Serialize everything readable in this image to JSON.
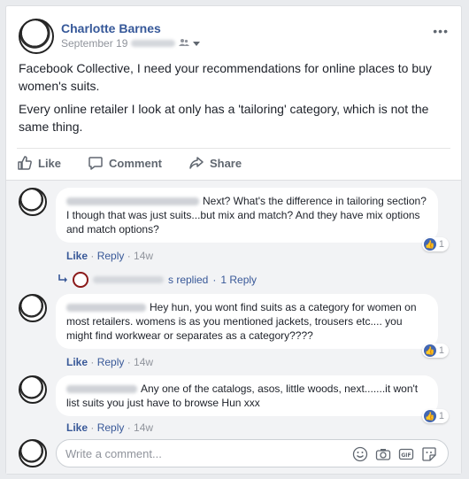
{
  "post": {
    "author": "Charlotte Barnes",
    "date": "September 19",
    "paragraphs": [
      "Facebook Collective, I need your recommendations for online places to buy women's suits.",
      "Every online retailer I look at only has a 'tailoring' category, which is not the same thing."
    ],
    "more_label": "•••",
    "icons": {
      "audience": "friends-icon",
      "dropdown": "chevron-down-icon",
      "more": "more-icon"
    }
  },
  "actions": {
    "like": "Like",
    "comment": "Comment",
    "share": "Share"
  },
  "comments": [
    {
      "text": "Next? What's the difference in tailoring section? I though that was just suits...but mix and match? And they have mix options and match options?",
      "like_label": "Like",
      "reply_label": "Reply",
      "time": "14w",
      "reactions": "1"
    },
    {
      "text": "Hey hun, you wont find suits as a category for women on most retailers. womens is as you mentioned jackets, trousers etc.... you might find workwear or separates as a category????",
      "like_label": "Like",
      "reply_label": "Reply",
      "time": "14w",
      "reactions": "1"
    },
    {
      "text": "Any one of the catalogs, asos, little woods, next.......it won't list suits you just have to browse Hun xxx",
      "like_label": "Like",
      "reply_label": "Reply",
      "time": "14w",
      "reactions": "1"
    }
  ],
  "replies": {
    "replied_text": "s replied",
    "separator": "·",
    "count_text": "1 Reply"
  },
  "composer": {
    "placeholder": "Write a comment..."
  },
  "colors": {
    "link": "#365899",
    "like_blue": "#4267b2",
    "background": "#e9ebee"
  }
}
